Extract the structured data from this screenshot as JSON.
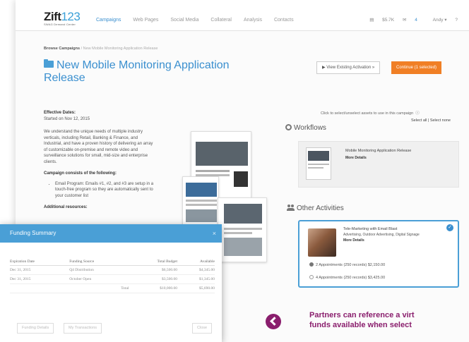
{
  "app": {
    "logo_text": "Zift",
    "logo_num": "123",
    "logo_sub": "SWAG Demand Center"
  },
  "nav": {
    "items": [
      "Campaigns",
      "Web Pages",
      "Social Media",
      "Collateral",
      "Analysis",
      "Contacts"
    ],
    "active_index": 0,
    "right": {
      "funds": "$5.7K",
      "messages": "4",
      "user": "Andy",
      "help": "?"
    }
  },
  "breadcrumb": {
    "root": "Browse Campaigns",
    "separator": "/",
    "current": "New Mobile Monitoring Application Release"
  },
  "page": {
    "title": "New Mobile Monitoring Application Release",
    "view_button": "View Existing Activation »",
    "continue_button": "Continue (1 selected)"
  },
  "details": {
    "effective_label": "Effective Dates:",
    "effective_value": "Started on Nov 12, 2015",
    "description": "We understand the unique needs of multiple industry verticals, including Retail, Banking & Finance, and Industrial, and have a proven history of delivering an array of customizable on-premise and remote video and surveillance solutions for small, mid-size and enterprise clients.",
    "consists_label": "Campaign consists of the following:",
    "bullet": "Email Program: Emails #1, #2, and #3 are setup in a touch-free program so they are automatically sent to your customer list",
    "additional_label": "Additional resources:"
  },
  "selection": {
    "note": "Click to select/unselect assets to use in this campaign",
    "select_all": "Select all",
    "select_none": "Select none"
  },
  "workflows": {
    "heading": "Workflows",
    "card_title": "Mobile Monitoring Application Release",
    "card_link": "More Details"
  },
  "activities": {
    "heading": "Other Activities",
    "card_title": "Tele-Marketing with Email Blast",
    "card_sub": "Advertising, Outdoor Advertising, Digital Signage",
    "card_link": "More Details",
    "options": [
      {
        "label": "2 Appointments (250 records)",
        "price": "$2,150.00",
        "selected": true
      },
      {
        "label": "4 Appointments (250 records)",
        "price": "$3,425.00",
        "selected": false
      }
    ]
  },
  "funding_modal": {
    "title": "Funding Summary",
    "close": "×",
    "columns": [
      "Expiration Date",
      "Funding Source",
      "Total Budget",
      "Available"
    ],
    "rows": [
      [
        "Dec 31, 2015",
        "Q4 Distribution",
        "$6,500.00",
        "$4,345.00"
      ],
      [
        "Dec 31, 2015",
        "October Open",
        "$3,500.00",
        "$1,345.00"
      ]
    ],
    "total_label": "Total",
    "total_budget": "$10,000.00",
    "total_available": "$5,690.00",
    "buttons": {
      "details": "Funding Details",
      "transactions": "My Transactions",
      "close": "Close"
    }
  },
  "callout": {
    "line1": "Partners can reference a virt",
    "line2": "funds available when select"
  },
  "colors": {
    "accent_blue": "#3a8fcf",
    "orange": "#f07f25",
    "callout_purple": "#8a1e6d"
  }
}
